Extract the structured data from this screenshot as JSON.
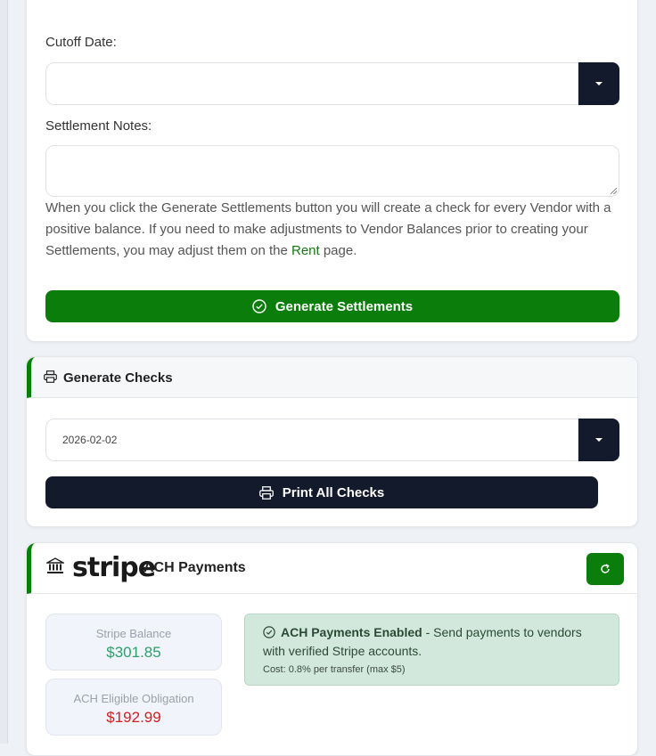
{
  "settlements": {
    "cutoff_label": "Cutoff Date:",
    "cutoff_value": "",
    "notes_label": "Settlement Notes:",
    "help_before_link": "When you click the Generate Settlements button you will create a check for every Vendor with a positive balance. If you need to make adjustments to Vendor Balances prior to creating your Settlements, you may adjust them on the ",
    "help_link": "Rent",
    "help_after_link": " page.",
    "generate_label": "Generate Settlements"
  },
  "checks": {
    "title": "Generate Checks",
    "date_value": "2026-02-02",
    "print_label": "Print All Checks"
  },
  "ach": {
    "logo_text": "stripe",
    "title": "ACH Payments",
    "balance_label": "Stripe Balance",
    "balance_value": "$301.85",
    "obligation_label": "ACH Eligible Obligation",
    "obligation_value": "$192.99",
    "alert_title": "ACH Payments Enabled",
    "alert_text": " - Send payments to vendors with verified Stripe accounts.",
    "alert_cost": "Cost: 0.8% per transfer (max $5)"
  },
  "colors": {
    "brand_green": "#0b7d0b",
    "dark_button": "#131a2b",
    "balance_green": "#2e9e6b",
    "obligation_red": "#d11f1f"
  },
  "icons": {
    "generate": "check-circle-icon",
    "checks_header": "printer-icon",
    "print_button": "printer-icon",
    "bank": "bank-icon",
    "refresh": "refresh-icon",
    "alert": "check-circle-icon"
  }
}
